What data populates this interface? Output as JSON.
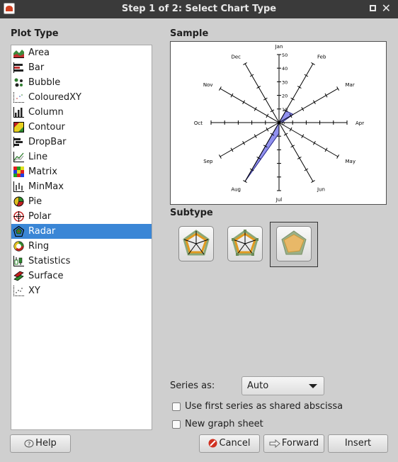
{
  "window": {
    "title": "Step 1 of 2: Select Chart Type"
  },
  "plot_type": {
    "heading": "Plot Type",
    "selected": "Radar",
    "items": [
      {
        "label": "Area",
        "icon": "area-chart-icon"
      },
      {
        "label": "Bar",
        "icon": "bar-chart-icon"
      },
      {
        "label": "Bubble",
        "icon": "bubble-chart-icon"
      },
      {
        "label": "ColouredXY",
        "icon": "coloured-xy-icon"
      },
      {
        "label": "Column",
        "icon": "column-chart-icon"
      },
      {
        "label": "Contour",
        "icon": "contour-chart-icon"
      },
      {
        "label": "DropBar",
        "icon": "dropbar-chart-icon"
      },
      {
        "label": "Line",
        "icon": "line-chart-icon"
      },
      {
        "label": "Matrix",
        "icon": "matrix-chart-icon"
      },
      {
        "label": "MinMax",
        "icon": "minmax-chart-icon"
      },
      {
        "label": "Pie",
        "icon": "pie-chart-icon"
      },
      {
        "label": "Polar",
        "icon": "polar-chart-icon"
      },
      {
        "label": "Radar",
        "icon": "radar-chart-icon"
      },
      {
        "label": "Ring",
        "icon": "ring-chart-icon"
      },
      {
        "label": "Statistics",
        "icon": "statistics-chart-icon"
      },
      {
        "label": "Surface",
        "icon": "surface-chart-icon"
      },
      {
        "label": "XY",
        "icon": "xy-chart-icon"
      }
    ]
  },
  "sample": {
    "heading": "Sample"
  },
  "chart_data": {
    "type": "radar",
    "categories": [
      "Jan",
      "Feb",
      "Mar",
      "Apr",
      "May",
      "Jun",
      "Jul",
      "Aug",
      "Sep",
      "Oct",
      "Nov",
      "Dec"
    ],
    "series": [
      {
        "values": [
          0,
          10,
          12,
          2,
          0,
          0,
          8,
          50,
          0,
          8,
          0,
          0
        ],
        "color": "#9090ee"
      }
    ],
    "radial_ticks": [
      "0",
      "10",
      "20",
      "30",
      "40",
      "50"
    ],
    "rlim": [
      0,
      50
    ]
  },
  "subtype": {
    "heading": "Subtype",
    "selected_index": 2
  },
  "options": {
    "series_as_label": "Series as:",
    "series_as_value": "Auto",
    "shared_abscissa_label": "Use first series as shared abscissa",
    "new_sheet_label": "New graph sheet"
  },
  "buttons": {
    "help": "Help",
    "cancel": "Cancel",
    "forward": "Forward",
    "insert": "Insert"
  }
}
